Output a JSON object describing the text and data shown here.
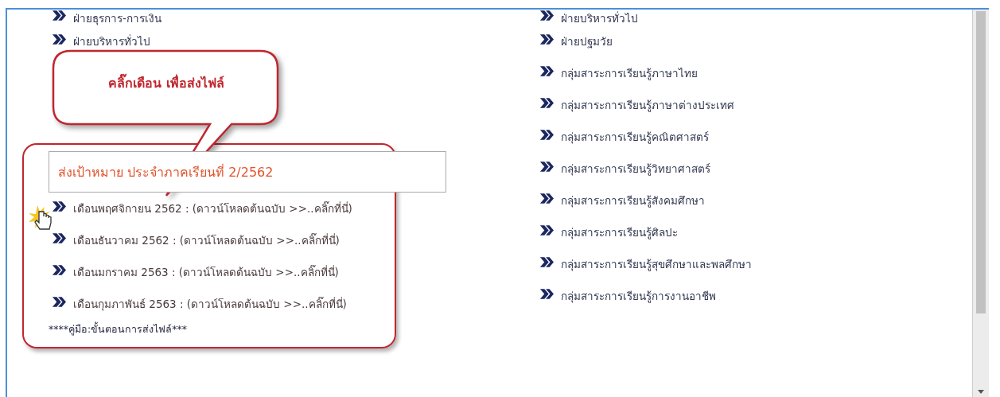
{
  "left_column": {
    "items": [
      {
        "label": "ฝ่ายธุรการ-การเงิน"
      },
      {
        "label": "ฝ่ายบริหารทั่วไป"
      }
    ]
  },
  "targets_panel": {
    "heading": "ส่งเป้าหมาย ประจำภาคเรียนที่ 2/2562",
    "months": [
      {
        "label": "เดือนพฤศจิกายน 2562 : (ดาวน์โหลดต้นฉบับ >>..คลิ๊กที่นี่)"
      },
      {
        "label": "เดือนธันวาคม 2562 : (ดาวน์โหลดต้นฉบับ >>..คลิ๊กที่นี่)"
      },
      {
        "label": "เดือนมกราคม 2563 : (ดาวน์โหลดต้นฉบับ >>..คลิ๊กที่นี่)"
      },
      {
        "label": "เดือนกุมภาพันธ์ 2563 : (ดาวน์โหลดต้นฉบับ >>..คลิ๊กที่นี่)"
      }
    ],
    "manual_link": "****คู่มือ:ขั้นตอนการส่งไฟล์***"
  },
  "right_column": {
    "items": [
      {
        "label": "ฝ่ายบริหารทั่วไป"
      },
      {
        "label": "ฝ่ายปฐมวัย"
      },
      {
        "label": "กลุ่มสาระการเรียนรู้ภาษาไทย"
      },
      {
        "label": "กลุ่มสาระการเรียนรู้ภาษาต่างประเทศ"
      },
      {
        "label": "กลุ่มสาระการเรียนรู้คณิตศาสตร์"
      },
      {
        "label": "กลุ่มสาระการเรียนรู้วิทยาศาสตร์"
      },
      {
        "label": "กลุ่มสาระการเรียนรู้สังคมศึกษา"
      },
      {
        "label": "กลุ่มสาระการเรียนรู้ศิลปะ"
      },
      {
        "label": "กลุ่มสาระการเรียนรู้สุขศึกษาและพลศึกษา"
      },
      {
        "label": "กลุ่มสาระการเรียนรู้การงานอาชีพ"
      }
    ]
  },
  "callout": {
    "text": "คลิ๊กเดือน เพื่อส่งไฟล์"
  }
}
